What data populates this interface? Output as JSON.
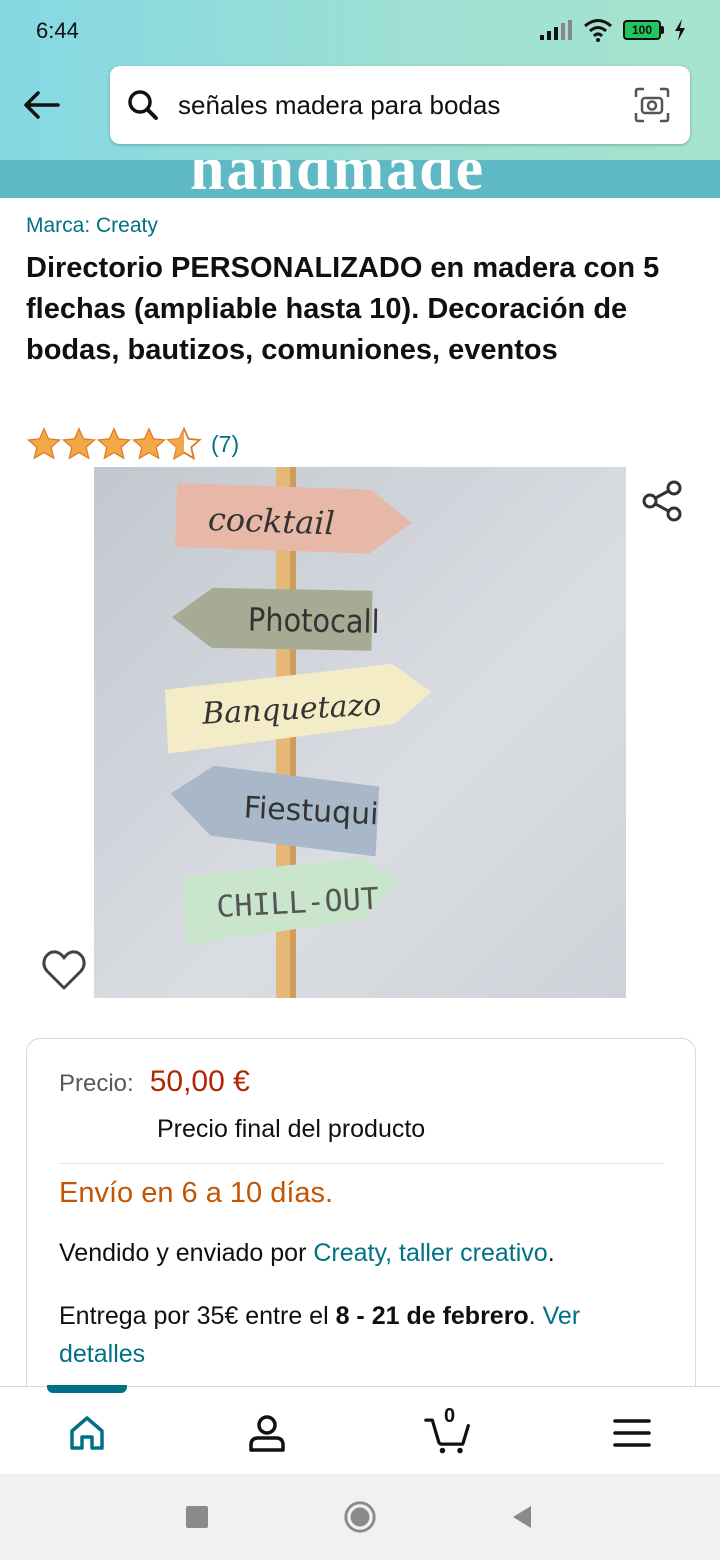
{
  "status_bar": {
    "time": "6:44",
    "battery": "100"
  },
  "search": {
    "query": "señales madera para bodas"
  },
  "banner": {
    "text": "handmade"
  },
  "product": {
    "brand": "Marca: Creaty",
    "title": "Directorio PERSONALIZADO en madera con 5 flechas (ampliable hasta 10). Decoración de bodas, bautizos, comuniones, eventos",
    "rating": 4.5,
    "rating_count": "(7)",
    "image_signs": [
      "cocktail",
      "Photocall",
      "Banquetazo",
      "Fiestuqui",
      "CHILL-OUT"
    ]
  },
  "price_card": {
    "price_label": "Precio:",
    "price_value": "50,00 €",
    "price_note": "Precio final del producto",
    "shipping_time": "Envío en 6 a 10 días.",
    "seller_prefix": "Vendido y enviado por ",
    "seller_name": "Creaty, taller creativo",
    "seller_suffix": ".",
    "delivery_prefix": "Entrega por 35€ entre el ",
    "delivery_dates": "8 - 21 de febrero",
    "delivery_suffix": ". ",
    "delivery_link": "Ver detalles"
  },
  "bottom_nav": {
    "cart_count": "0"
  },
  "colors": {
    "link": "#007185",
    "price": "#b12704",
    "shipping": "#c45500",
    "star": "#f3a847",
    "header_gradient_start": "#84d8e3",
    "banner": "#5fb9c4"
  }
}
